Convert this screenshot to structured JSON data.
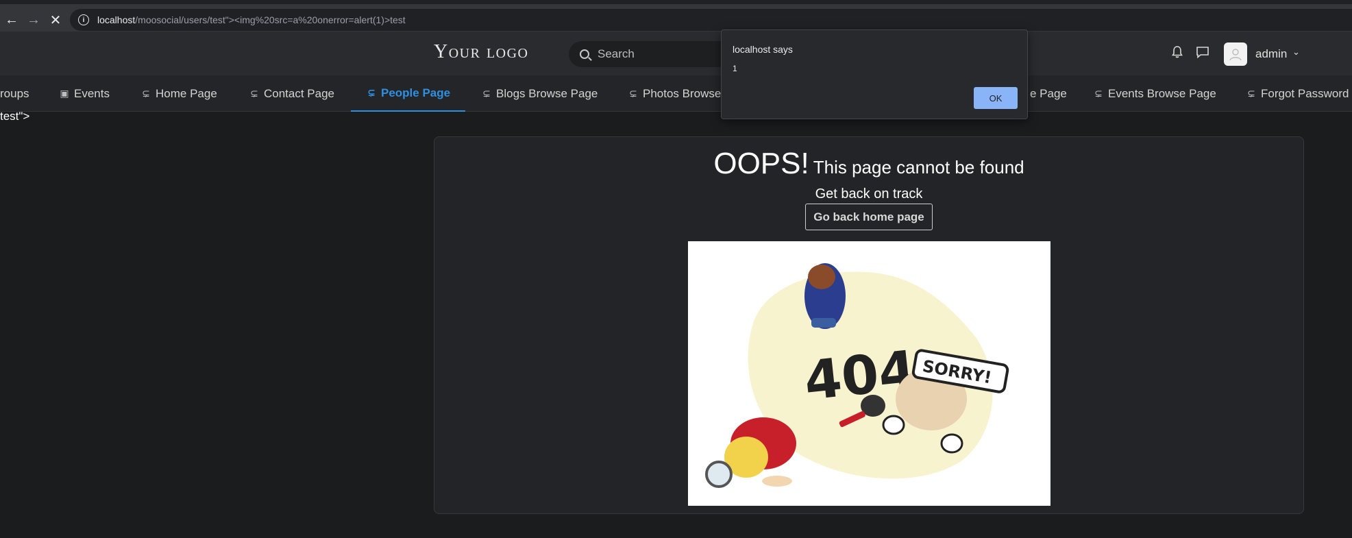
{
  "browser": {
    "url_host": "localhost",
    "url_rest": "/moosocial/users/test\"><img%20src=a%20onerror=alert(1)>test"
  },
  "header": {
    "logo": "Your logo",
    "search_placeholder": "Search",
    "user_name": "admin"
  },
  "menu": {
    "items": [
      {
        "label": "roups",
        "icon": "groups-icon"
      },
      {
        "label": "Events",
        "icon": "calendar-icon"
      },
      {
        "label": "Home Page",
        "icon": "page-icon"
      },
      {
        "label": "Contact Page",
        "icon": "page-icon"
      },
      {
        "label": "People Page",
        "icon": "page-icon",
        "active": true
      },
      {
        "label": "Blogs Browse Page",
        "icon": "page-icon"
      },
      {
        "label": "Photos Browse",
        "icon": "page-icon"
      },
      {
        "label": "e Page",
        "icon": "page-icon"
      },
      {
        "label": "Events Browse Page",
        "icon": "page-icon"
      },
      {
        "label": "Forgot Password",
        "icon": "page-icon"
      }
    ]
  },
  "stray_text": "test\">",
  "content": {
    "oops": "OOPS!",
    "oops_sub": "This page cannot be found",
    "track": "Get back on track",
    "home_button": "Go back home page",
    "illustration_text_404": "404",
    "illustration_text_sorry": "SORRY!"
  },
  "dialog": {
    "title": "localhost says",
    "message": "1",
    "ok": "OK"
  },
  "colors": {
    "accent": "#2f8fe0",
    "dialog_button": "#8ab4f8"
  }
}
